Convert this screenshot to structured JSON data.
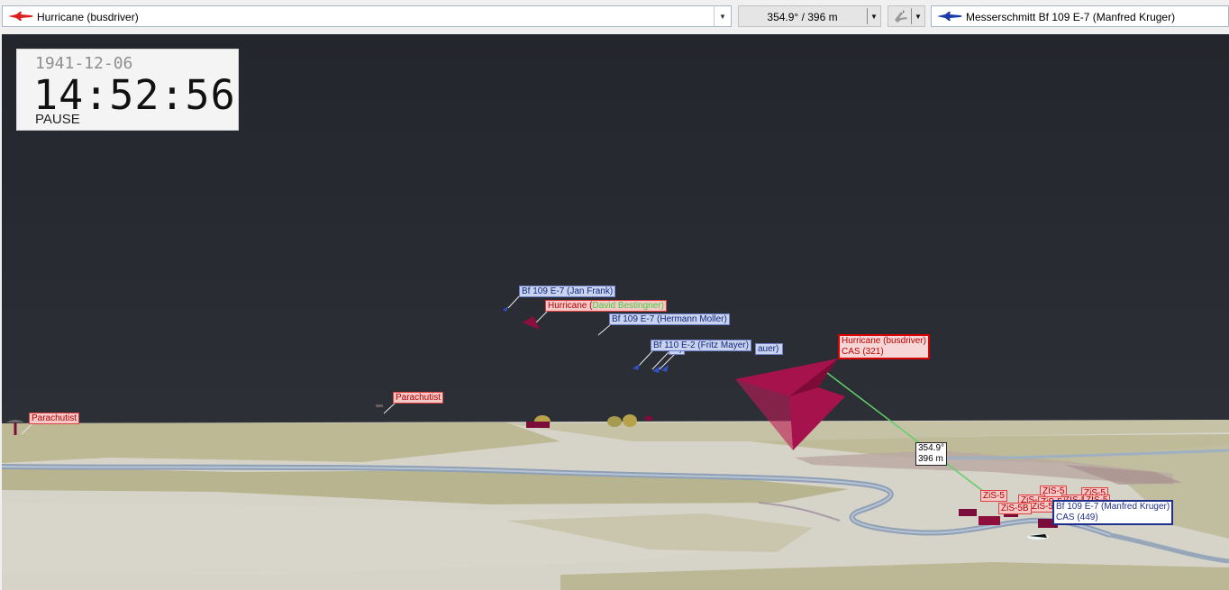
{
  "toolbar": {
    "own_aircraft": "Hurricane (busdriver)",
    "bearing_range": "354.9° / 396 m",
    "target_aircraft": "Messerschmitt Bf 109 E-7 (Manfred Kruger)",
    "colors": {
      "allied": "#e02020",
      "axis": "#1a3aa8"
    }
  },
  "clock": {
    "date": "1941-12-06",
    "time": "14:52:56",
    "state": "PAUSE"
  },
  "labels": {
    "bf109_jan": "Bf 109 E-7 (Jan Frank)",
    "hurricane_other_prefix": "Hurricane (",
    "hurricane_other_name": "David Bestingner)",
    "bf109_hermann": "Bf 109 E-7 (Hermann Moller)",
    "bf110_fritz": "Bf 110 E-2 (Fritz Mayer)",
    "hidden_label_tail": "auer)",
    "hidden_label_tail2": "er)",
    "parachutist_left": "Parachutist",
    "parachutist_mid": "Parachutist",
    "own_name": "Hurricane (busdriver)",
    "own_status": "CAS (321)",
    "distance_bearing": "354.9°",
    "distance_range": "396 m",
    "target_name": "Bf 109 E-7 (Manfred Kruger)",
    "target_status": "CAS (449)",
    "zis_a": "ZiS-5",
    "zis_b": "ZiS-5B",
    "zis_c": "ZiS-5",
    "zis_d": "ZiS-5",
    "zis_e": "ZiS-5",
    "zis_f": "ZIS-5",
    "zis_g": "ZiS-5",
    "zis_h": "ZIS-5",
    "zis_i": "ZIS-5"
  }
}
